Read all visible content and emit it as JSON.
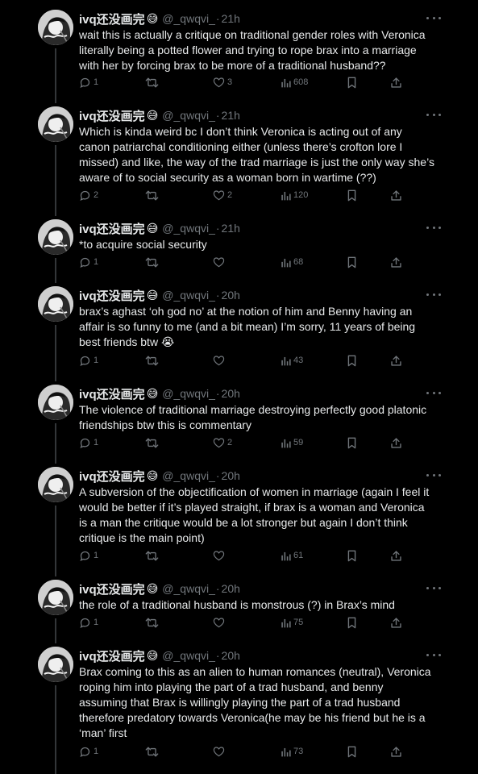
{
  "user": {
    "name": "ivq还没画完",
    "emoji": "😅",
    "handle": "@_qwqvi_"
  },
  "colors": {
    "background": "#000000",
    "text": "#e7e9ea",
    "muted": "#71767b",
    "thread_line": "#333639"
  },
  "icons": {
    "reply": "reply-icon",
    "retweet": "retweet-icon",
    "like": "heart-icon",
    "views": "views-icon",
    "bookmark": "bookmark-icon",
    "share": "share-icon",
    "more": "more-icon"
  },
  "tweets": [
    {
      "time": "21h",
      "text": "wait this is actually a critique on traditional gender roles with Veronica\nliterally being a potted flower and trying to rope brax into a marriage\nwith her by forcing brax to be more of a traditional husband??",
      "replies": "1",
      "retweets": "",
      "likes": "3",
      "views": "608"
    },
    {
      "time": "21h",
      "text": "Which is kinda weird bc I don’t think Veronica is acting out of any\ncanon patriarchal conditioning either (unless there’s crofton lore I\nmissed) and like, the way of the trad marriage is just the only way she’s\naware of to social security as a woman born in wartime (??)",
      "replies": "2",
      "retweets": "",
      "likes": "2",
      "views": "120"
    },
    {
      "time": "21h",
      "text": "*to acquire social security",
      "replies": "1",
      "retweets": "",
      "likes": "",
      "views": "68"
    },
    {
      "time": "20h",
      "text": "brax’s aghast ‘oh god no’ at the notion of him and Benny having an\naffair is so funny to me (and a bit mean) I’m sorry, 11 years of being\nbest friends btw 😭",
      "replies": "1",
      "retweets": "",
      "likes": "",
      "views": "43"
    },
    {
      "time": "20h",
      "text": "The violence of traditional marriage destroying perfectly good platonic\nfriendships btw this is commentary",
      "replies": "1",
      "retweets": "",
      "likes": "2",
      "views": "59"
    },
    {
      "time": "20h",
      "text": "A subversion of the objectification of women in marriage (again I feel it\nwould be better if it’s played straight, if brax is a woman and Veronica\nis a man the critique would be a lot stronger but again I don’t think\ncritique is the main point)",
      "replies": "1",
      "retweets": "",
      "likes": "",
      "views": "61"
    },
    {
      "time": "20h",
      "text": "the role of a traditional husband is monstrous (?) in Brax’s mind",
      "replies": "1",
      "retweets": "",
      "likes": "",
      "views": "75"
    },
    {
      "time": "20h",
      "text": "Brax coming to this as an alien to human romances (neutral), Veronica\nroping him into playing the part of a trad husband, and benny\nassuming that Brax is willingly playing the part of a trad husband\ntherefore predatory towards Veronica(he may be his friend but he is a\n‘man’ first",
      "replies": "1",
      "retweets": "",
      "likes": "",
      "views": "73"
    }
  ]
}
